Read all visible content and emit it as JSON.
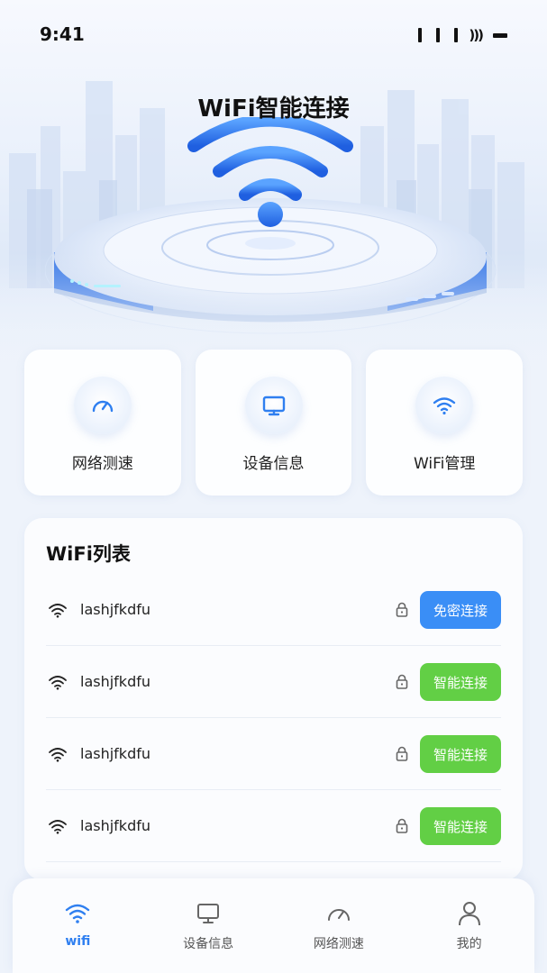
{
  "status_bar": {
    "time": "9:41"
  },
  "app": {
    "title": "WiFi智能连接"
  },
  "quick_actions": [
    {
      "label": "网络测速",
      "icon": "speedometer-icon"
    },
    {
      "label": "设备信息",
      "icon": "monitor-icon"
    },
    {
      "label": "WiFi管理",
      "icon": "wifi-icon"
    }
  ],
  "wifi_list": {
    "title": "WiFi列表",
    "items": [
      {
        "ssid": "lashjfkdfu",
        "button": "免密连接",
        "button_color": "#3a8ef6"
      },
      {
        "ssid": "lashjfkdfu",
        "button": "智能连接",
        "button_color": "#62cf45"
      },
      {
        "ssid": "lashjfkdfu",
        "button": "智能连接",
        "button_color": "#62cf45"
      },
      {
        "ssid": "lashjfkdfu",
        "button": "智能连接",
        "button_color": "#62cf45"
      }
    ]
  },
  "bottom_nav": {
    "items": [
      {
        "label": "wifi",
        "icon": "wifi-icon",
        "active": true
      },
      {
        "label": "设备信息",
        "icon": "monitor-icon"
      },
      {
        "label": "网络测速",
        "icon": "speedometer-icon"
      },
      {
        "label": "我的",
        "icon": "user-icon"
      }
    ]
  },
  "colors": {
    "accent": "#2f7ff0",
    "blue_button": "#3a8ef6",
    "green_button": "#62cf45"
  }
}
